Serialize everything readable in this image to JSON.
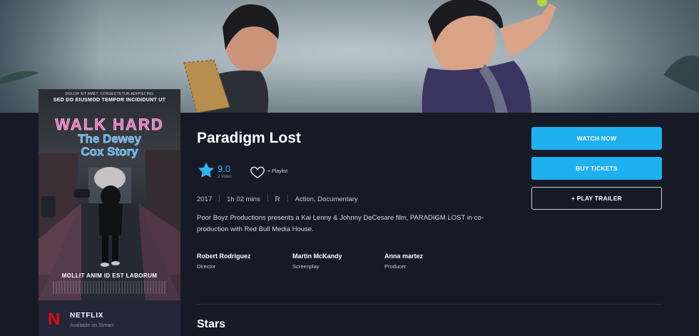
{
  "movie": {
    "title": "Paradigm Lost",
    "rating": "9.0",
    "votes": "2 Votes",
    "playlist_label": "+ Playlist",
    "year": "2017",
    "runtime": "1h 02 mins",
    "certificate": "R",
    "genres": "Action, Documentary",
    "description": "Poor Boyz Productions presents a Kai Lenny & Johnny DeCesare film, PARADIGM LOST in co-production with Red Bull Media House."
  },
  "crew": [
    {
      "name": "Robert Rodriguez",
      "role": "Director"
    },
    {
      "name": "Martin McKandy",
      "role": "Screenplay"
    },
    {
      "name": "Anna martez",
      "role": "Producer"
    }
  ],
  "poster": {
    "top_line_small": "DOLOR SIT AMET, CONSECTETUR ADIPISCING",
    "top_line": "SED DO EIUSMOD TEMPOR INCIDIDUNT UT",
    "title_line1": "WALK HARD",
    "title_line2": "The Dewey",
    "title_line3": "Cox Story",
    "tagline": "MOLLIT ANIM ID EST LABORUM"
  },
  "provider": {
    "logo": "N",
    "name": "NETFLIX",
    "subtitle": "Available on Stream"
  },
  "actions": {
    "watch_now": "WATCH NOW",
    "buy_tickets": "BUY TICKETS",
    "play_trailer": "+ PLAY TRAILER"
  },
  "sections": {
    "stars_heading": "Stars"
  },
  "colors": {
    "accent": "#1fb0f0",
    "background": "#161a26",
    "netflix_red": "#e50914",
    "poster_title_pink": "#f06ab9",
    "poster_title_blue": "#3fa9f5"
  },
  "icons": {
    "rating": "star-icon",
    "playlist": "heart-icon",
    "provider": "netflix-logo"
  }
}
